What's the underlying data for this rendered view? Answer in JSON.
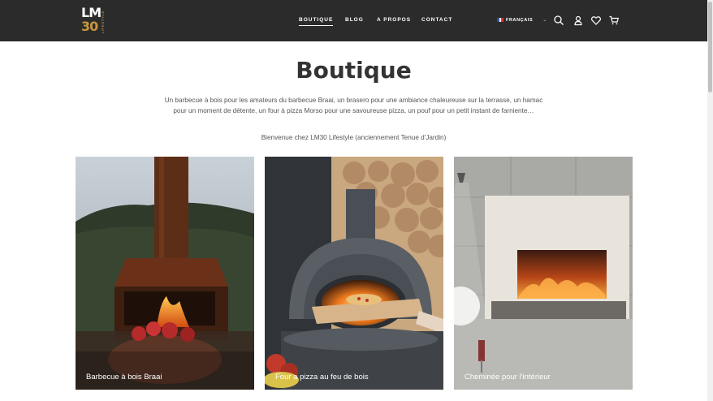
{
  "header": {
    "logo": {
      "letters": "LM",
      "number": "30",
      "tagline": "LIFESTYLE"
    },
    "nav": [
      {
        "label": "BOUTIQUE",
        "active": true
      },
      {
        "label": "BLOG",
        "active": false
      },
      {
        "label": "A PROPOS",
        "active": false
      },
      {
        "label": "CONTACT",
        "active": false
      }
    ],
    "language": {
      "label": "FRANÇAIS",
      "flag": "france-flag-icon"
    },
    "icons": [
      "search-icon",
      "user-icon",
      "heart-icon",
      "cart-icon"
    ]
  },
  "page": {
    "title": "Boutique",
    "intro": "Un barbecue à bois pour les amateurs du barbecue Braai, un brasero pour une ambiance chaleureuse sur la terrasse, un hamac pour un moment de détente, un four à pizza Morso pour une savoureuse pizza, un pouf pour un petit instant de farniente…",
    "welcome": "Bienvenue chez LM30 Lifestyle (anciennement Tenue d'Jardin)"
  },
  "categories": [
    {
      "label": "Barbecue à bois Braai"
    },
    {
      "label": "Four a pizza au feu de bois"
    },
    {
      "label": "Cheminée pour l'intérieur"
    }
  ],
  "colors": {
    "header_bg": "#2b2b2b",
    "accent": "#c8963e"
  }
}
